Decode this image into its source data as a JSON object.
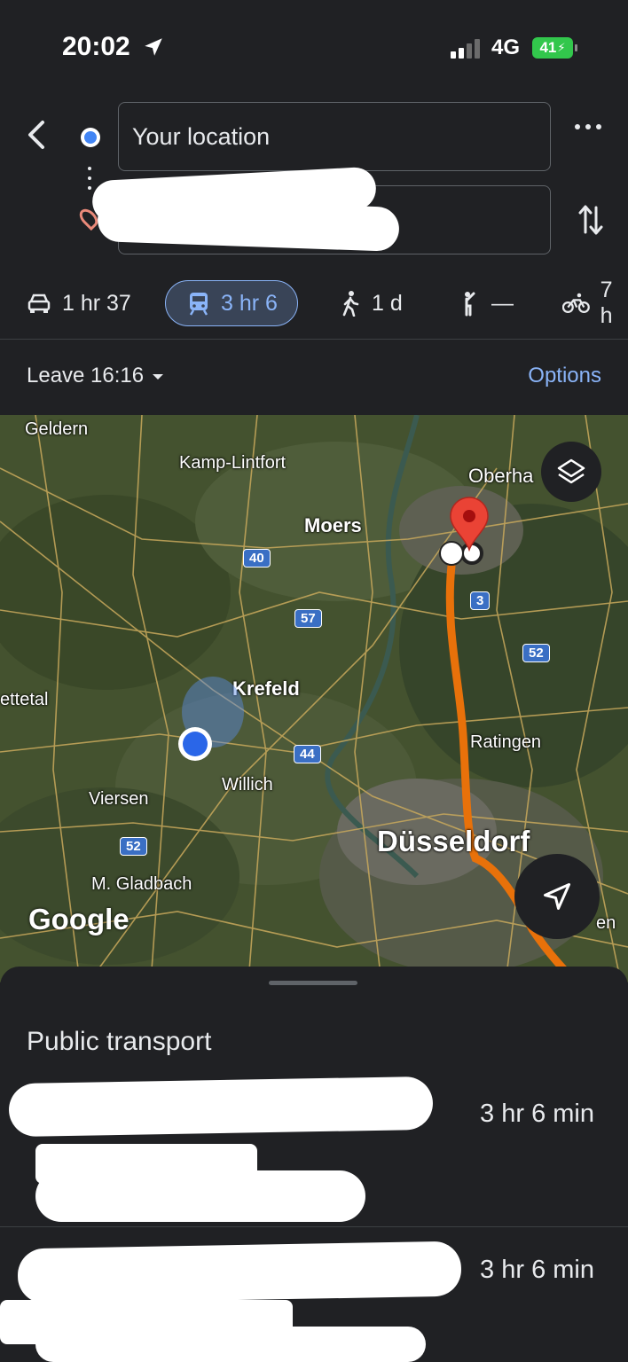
{
  "status_bar": {
    "time": "20:02",
    "network": "4G",
    "battery": "41"
  },
  "search": {
    "origin_value": "Your location",
    "destination_value": ""
  },
  "modes": [
    {
      "icon": "car-icon",
      "label": "1 hr 37",
      "active": false
    },
    {
      "icon": "train-icon",
      "label": "3 hr 6",
      "active": true
    },
    {
      "icon": "walk-icon",
      "label": "1 d",
      "active": false
    },
    {
      "icon": "ride-hail-icon",
      "label": "—",
      "active": false
    },
    {
      "icon": "bike-icon",
      "label": "7 h",
      "active": false
    }
  ],
  "leave": {
    "label": "Leave 16:16"
  },
  "options_label": "Options",
  "map": {
    "labels": {
      "geldern": "Geldern",
      "kamp_lintfort": "Kamp-Lintfort",
      "oberhausen": "Oberha",
      "moers": "Moers",
      "krefeld": "Krefeld",
      "nettetal": "ettetal",
      "ratingen": "Ratingen",
      "willich": "Willich",
      "viersen": "Viersen",
      "dusseldorf": "Düsseldorf",
      "mgladbach": "M. Gladbach",
      "hilden": "en"
    },
    "shields": {
      "a40": "40",
      "a57": "57",
      "a3": "3",
      "a52_east": "52",
      "a44": "44",
      "a52_west": "52"
    },
    "attribution": "Google",
    "colors": {
      "route": "#e8710a",
      "pin": "#ea4335",
      "location": "#2a66e8"
    }
  },
  "sheet": {
    "title": "Public transport",
    "routes": [
      {
        "duration": "3 hr 6 min"
      },
      {
        "duration": "3 hr 6 min"
      }
    ]
  }
}
